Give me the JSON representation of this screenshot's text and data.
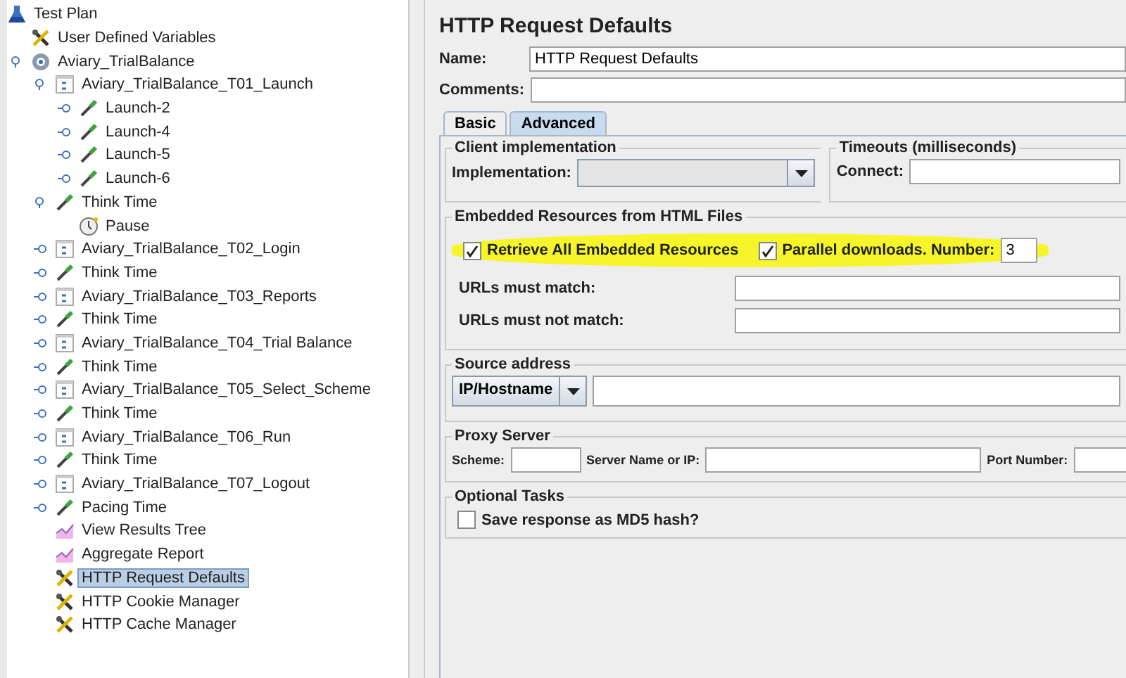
{
  "tree": [
    {
      "label": "Test Plan",
      "kind": "plan",
      "selected": false,
      "children": [
        {
          "label": "User Defined Variables",
          "kind": "config",
          "selected": false
        },
        {
          "label": "Aviary_TrialBalance",
          "kind": "threadgroup",
          "selected": false,
          "expanded": true,
          "children": [
            {
              "label": "Aviary_TrialBalance_T01_Launch",
              "kind": "controller",
              "selected": false,
              "expanded": true,
              "children": [
                {
                  "label": "Launch-2",
                  "kind": "sampler",
                  "selected": false,
                  "expanded": false
                },
                {
                  "label": "Launch-4",
                  "kind": "sampler",
                  "selected": false,
                  "expanded": false
                },
                {
                  "label": "Launch-5",
                  "kind": "sampler",
                  "selected": false,
                  "expanded": false
                },
                {
                  "label": "Launch-6",
                  "kind": "sampler",
                  "selected": false,
                  "expanded": false
                }
              ]
            },
            {
              "label": "Think Time",
              "kind": "sampler",
              "selected": false,
              "expanded": true,
              "children": [
                {
                  "label": "Pause",
                  "kind": "timer",
                  "selected": false
                }
              ]
            },
            {
              "label": "Aviary_TrialBalance_T02_Login",
              "kind": "controller",
              "selected": false,
              "expanded": false
            },
            {
              "label": "Think Time",
              "kind": "sampler",
              "selected": false,
              "expanded": false
            },
            {
              "label": "Aviary_TrialBalance_T03_Reports",
              "kind": "controller",
              "selected": false,
              "expanded": false
            },
            {
              "label": "Think Time",
              "kind": "sampler",
              "selected": false,
              "expanded": false
            },
            {
              "label": "Aviary_TrialBalance_T04_Trial Balance",
              "kind": "controller",
              "selected": false,
              "expanded": false
            },
            {
              "label": "Think Time",
              "kind": "sampler",
              "selected": false,
              "expanded": false
            },
            {
              "label": "Aviary_TrialBalance_T05_Select_Scheme",
              "kind": "controller",
              "selected": false,
              "expanded": false
            },
            {
              "label": "Think Time",
              "kind": "sampler",
              "selected": false,
              "expanded": false
            },
            {
              "label": "Aviary_TrialBalance_T06_Run",
              "kind": "controller",
              "selected": false,
              "expanded": false
            },
            {
              "label": "Think Time",
              "kind": "sampler",
              "selected": false,
              "expanded": false
            },
            {
              "label": "Aviary_TrialBalance_T07_Logout",
              "kind": "controller",
              "selected": false,
              "expanded": false
            },
            {
              "label": "Pacing Time",
              "kind": "sampler",
              "selected": false,
              "expanded": false
            },
            {
              "label": "View Results Tree",
              "kind": "listener",
              "selected": false
            },
            {
              "label": "Aggregate Report",
              "kind": "listener",
              "selected": false
            },
            {
              "label": "HTTP Request Defaults",
              "kind": "config",
              "selected": true
            },
            {
              "label": "HTTP Cookie Manager",
              "kind": "config",
              "selected": false
            },
            {
              "label": "HTTP Cache Manager",
              "kind": "config",
              "selected": false
            }
          ]
        }
      ]
    }
  ],
  "editor": {
    "title": "HTTP Request Defaults",
    "name_label": "Name:",
    "name_value": "HTTP Request Defaults",
    "comments_label": "Comments:",
    "tabs": [
      {
        "label": "Basic",
        "selected": false
      },
      {
        "label": "Advanced",
        "selected": true
      }
    ],
    "client": {
      "title": "Client implementation",
      "label": "Implementation:"
    },
    "timeouts": {
      "title": "Timeouts (milliseconds)",
      "label": "Connect:"
    },
    "embedded": {
      "title": "Embedded Resources from HTML Files",
      "highlighted": true,
      "retrieve": {
        "label": "Retrieve All Embedded Resources",
        "checked": true
      },
      "parallel": {
        "label": "Parallel downloads. Number:",
        "checked": true,
        "value": "3"
      },
      "must_match": "URLs must match:",
      "must_not_match": "URLs must not match:"
    },
    "source": {
      "title": "Source address",
      "type_value": "IP/Hostname"
    },
    "proxy": {
      "title": "Proxy Server",
      "scheme": "Scheme:",
      "server": "Server Name or IP:",
      "port": "Port Number:"
    },
    "optional": {
      "title": "Optional Tasks",
      "md5": {
        "label": "Save response as MD5 hash?",
        "checked": false
      }
    }
  }
}
